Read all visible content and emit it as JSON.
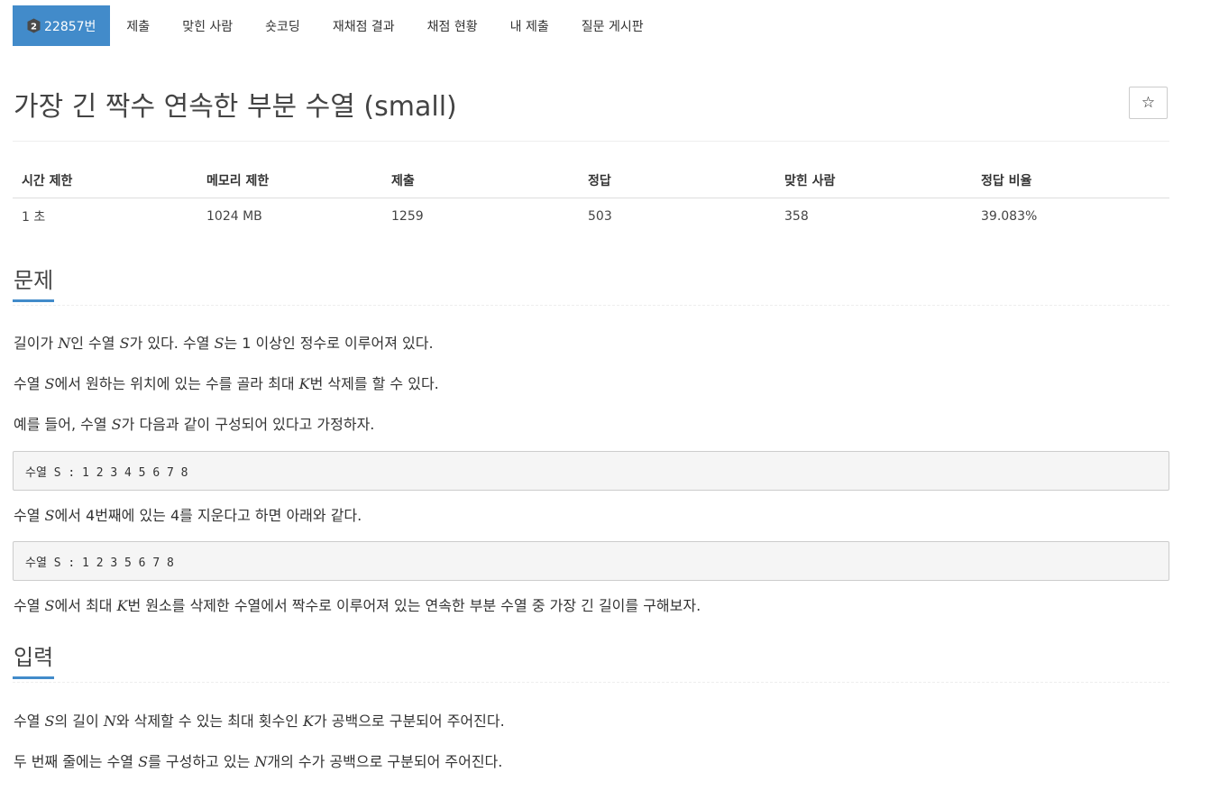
{
  "tabs": [
    {
      "label": "22857번",
      "active": true
    },
    {
      "label": "제출"
    },
    {
      "label": "맞힌 사람"
    },
    {
      "label": "숏코딩"
    },
    {
      "label": "재채점 결과"
    },
    {
      "label": "채점 현황"
    },
    {
      "label": "내 제출"
    },
    {
      "label": "질문 게시판"
    }
  ],
  "tier_badge": {
    "icon": "tier-icon",
    "level": "2",
    "color": "#4a4a4a"
  },
  "title": "가장 긴 짝수 연속한 부분 수열 (small)",
  "star_button": {
    "icon": "star-outline-icon",
    "glyph": "☆"
  },
  "info": {
    "headers": [
      "시간 제한",
      "메모리 제한",
      "제출",
      "정답",
      "맞힌 사람",
      "정답 비율"
    ],
    "values": [
      "1 초",
      "1024 MB",
      "1259",
      "503",
      "358",
      "39.083%"
    ]
  },
  "problem": {
    "heading": "문제",
    "p1": {
      "a": "길이가 ",
      "N": "N",
      "b": "인 수열 ",
      "S1": "S",
      "c": "가 있다. 수열 ",
      "S2": "S",
      "d": "는 1 이상인 정수로 이루어져 있다."
    },
    "p2": {
      "a": "수열 ",
      "S": "S",
      "b": "에서 원하는 위치에 있는 수를 골라 최대 ",
      "K": "K",
      "c": "번 삭제를 할 수 있다."
    },
    "p3": {
      "a": "예를 들어, 수열 ",
      "S": "S",
      "b": "가 다음과 같이 구성되어 있다고 가정하자."
    },
    "code1": "수열 S : 1 2 3 4 5 6 7 8",
    "p4": {
      "a": "수열 ",
      "S": "S",
      "b": "에서 4번째에 있는 4를 지운다고 하면 아래와 같다."
    },
    "code2": "수열 S : 1 2 3 5 6 7 8",
    "p5": {
      "a": "수열 ",
      "S": "S",
      "b": "에서 최대 ",
      "K": "K",
      "c": "번 원소를 삭제한 수열에서 짝수로 이루어져 있는 연속한 부분 수열 중 가장 긴 길이를 구해보자."
    }
  },
  "input": {
    "heading": "입력",
    "p1": {
      "a": "수열 ",
      "S": "S",
      "b": "의 길이 ",
      "N": "N",
      "c": "와 삭제할 수 있는 최대 횟수인 ",
      "K": "K",
      "d": "가 공백으로 구분되어 주어진다."
    },
    "p2": {
      "a": "두 번째 줄에는 수열 ",
      "S": "S",
      "b": "를 구성하고 있는 ",
      "N": "N",
      "c": "개의 수가 공백으로 구분되어 주어진다."
    }
  },
  "colors": {
    "accent": "#428bca",
    "text": "#333333",
    "code_bg": "#f5f5f5"
  }
}
